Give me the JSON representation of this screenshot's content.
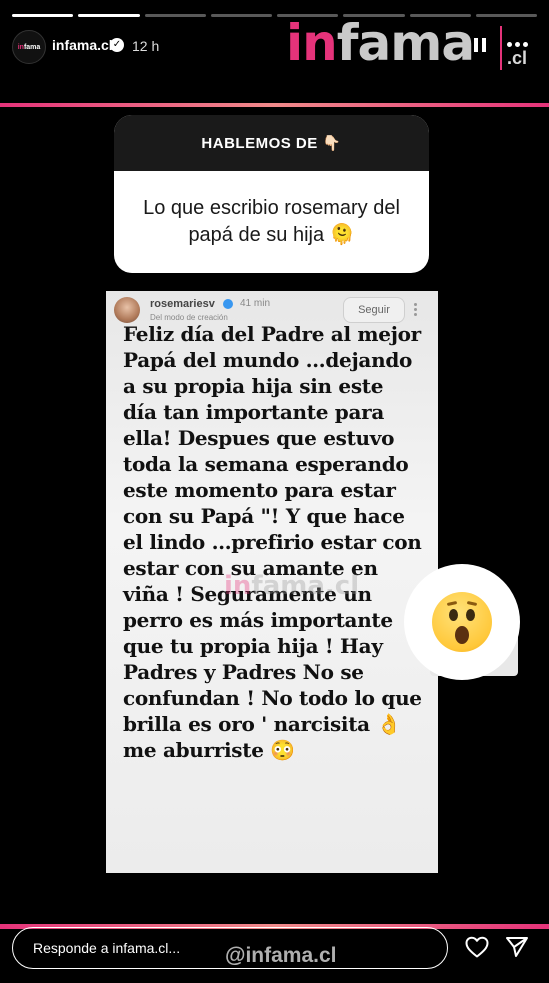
{
  "story": {
    "segments_total": 8,
    "segments_fill": [
      1,
      1,
      0,
      0,
      0,
      0,
      0,
      0
    ],
    "username": "infama.cl",
    "time_ago": "12 h",
    "avatar_text_a": "in",
    "avatar_text_b": "fama",
    "brand_a": "in",
    "brand_b": "fama",
    "brand_suffix": ".cl",
    "accent_color": "#e5337a"
  },
  "question_sticker": {
    "header": "HABLEMOS DE 👇🏻",
    "text": "Lo que escribio rosemary del papá de su hija 🫠"
  },
  "embedded_story": {
    "username": "rosemariesv",
    "time_ago": "41 min",
    "subtitle": "Del modo de creación",
    "follow_label": "Seguir",
    "message": "Feliz día del Padre al mejor Papá del mundo …dejando a su propia hija sin este día tan importante para ella! Despues que estuvo toda la semana esperando este momento para estar con su Papá \"! Y que hace el lindo …prefirio estar con estar con su amante en viña ! Seguramente un perro es más importante que tu propia hija ! Hay Padres y Padres No se confundan ! No todo lo que brilla es oro ' narcisita 👌 me aburriste 😳",
    "watermark_a": "in",
    "watermark_b": "fama.cl"
  },
  "reaction": {
    "emoji_name": "surprised-face-icon"
  },
  "footer": {
    "reply_placeholder": "Responde a infama.cl...",
    "handle": "@infama.cl"
  }
}
